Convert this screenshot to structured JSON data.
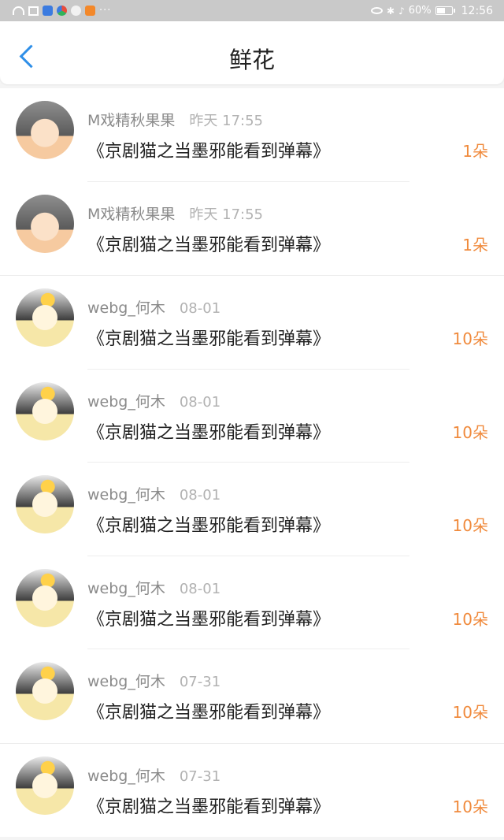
{
  "status_bar": {
    "battery": "60%",
    "time": "12:56",
    "overflow": "···"
  },
  "header": {
    "title": "鲜花"
  },
  "rows": [
    {
      "user": "M戏精秋果果",
      "time": "昨天 17:55",
      "work": "《京剧猫之当墨邪能看到弹幕》",
      "count": "1朵",
      "avatar": "anime-cat-boy"
    },
    {
      "user": "M戏精秋果果",
      "time": "昨天 17:55",
      "work": "《京剧猫之当墨邪能看到弹幕》",
      "count": "1朵",
      "avatar": "anime-cat-boy"
    },
    {
      "user": "webg_何木",
      "time": "08-01",
      "work": "《京剧猫之当墨邪能看到弹幕》",
      "count": "10朵",
      "avatar": "chibi-egg-girl"
    },
    {
      "user": "webg_何木",
      "time": "08-01",
      "work": "《京剧猫之当墨邪能看到弹幕》",
      "count": "10朵",
      "avatar": "chibi-egg-girl"
    },
    {
      "user": "webg_何木",
      "time": "08-01",
      "work": "《京剧猫之当墨邪能看到弹幕》",
      "count": "10朵",
      "avatar": "chibi-egg-girl"
    },
    {
      "user": "webg_何木",
      "time": "08-01",
      "work": "《京剧猫之当墨邪能看到弹幕》",
      "count": "10朵",
      "avatar": "chibi-egg-girl"
    },
    {
      "user": "webg_何木",
      "time": "07-31",
      "work": "《京剧猫之当墨邪能看到弹幕》",
      "count": "10朵",
      "avatar": "chibi-egg-girl"
    },
    {
      "user": "webg_何木",
      "time": "07-31",
      "work": "《京剧猫之当墨邪能看到弹幕》",
      "count": "10朵",
      "avatar": "chibi-egg-girl"
    }
  ],
  "colors": {
    "accent": "#2f8fe8",
    "count": "#f08a3c"
  }
}
